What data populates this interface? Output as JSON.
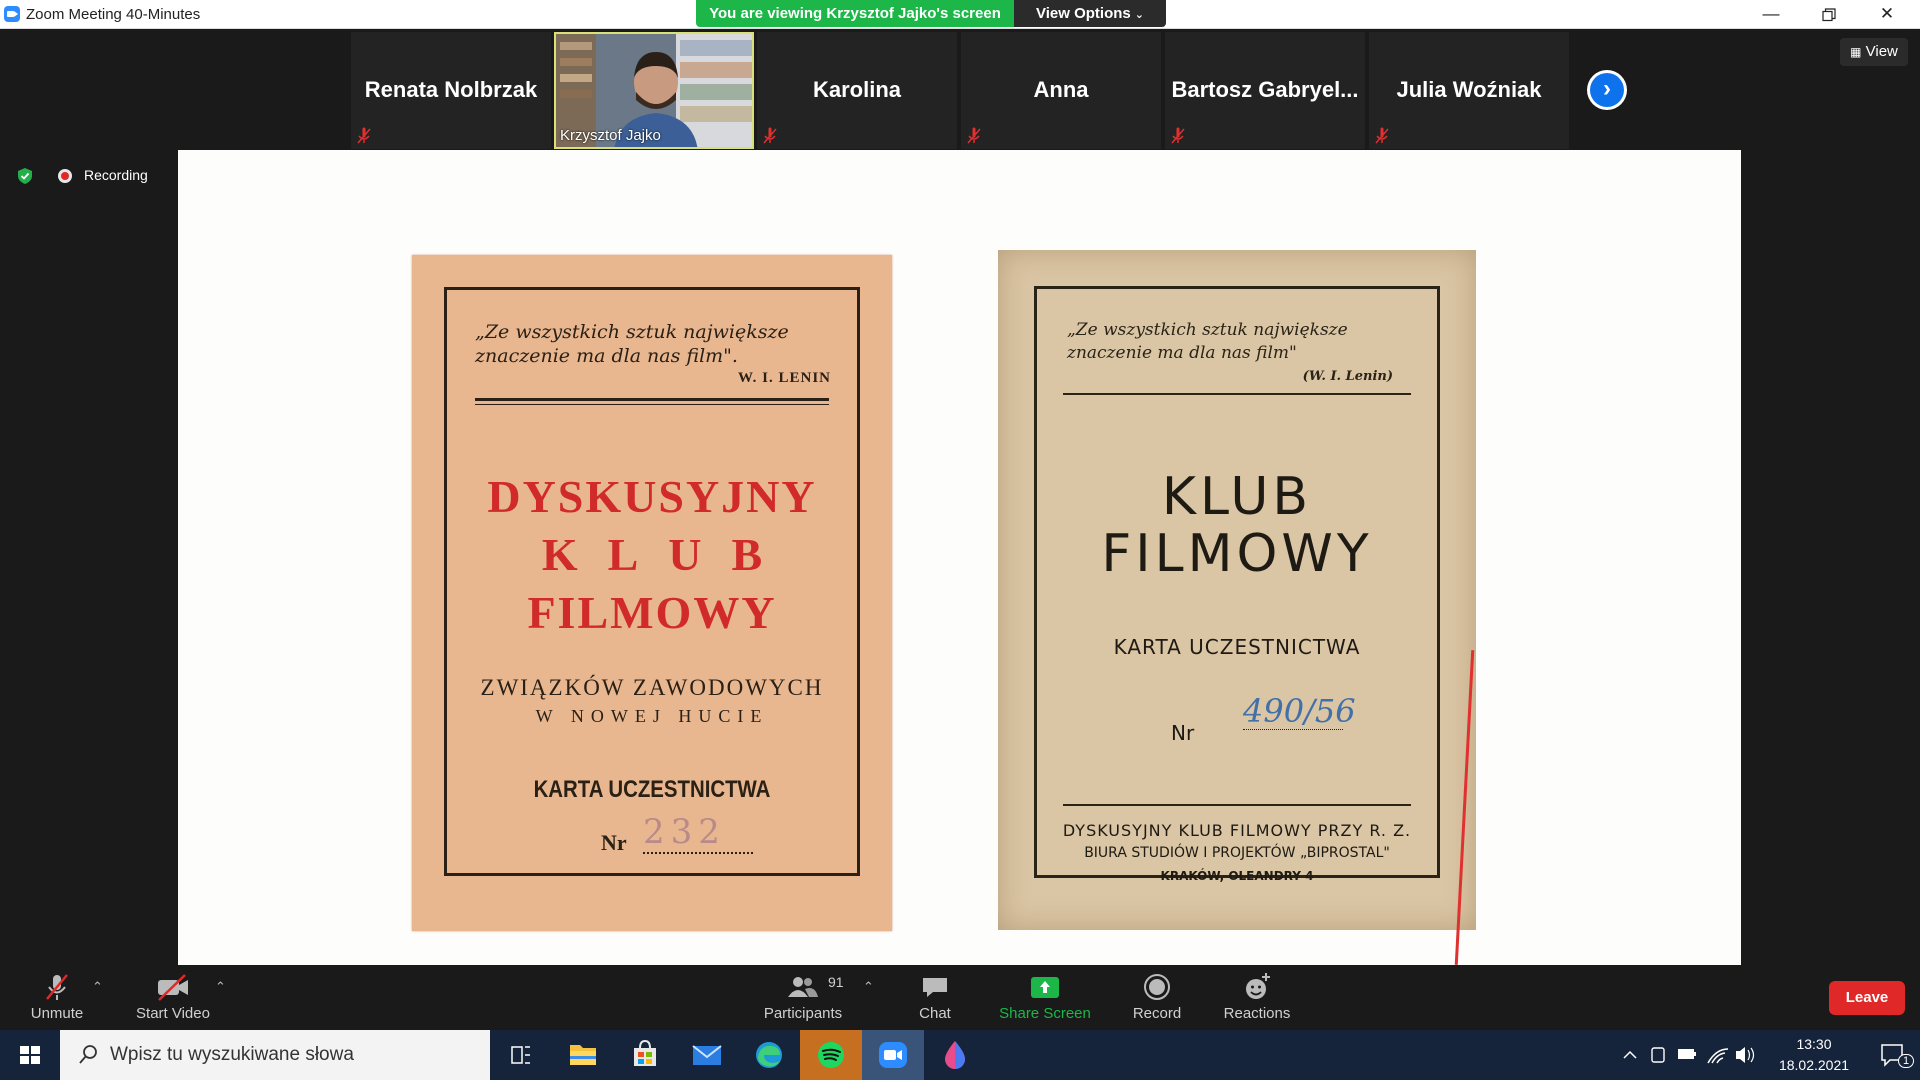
{
  "window": {
    "title": "Zoom Meeting 40-Minutes",
    "share_banner": "You are viewing Krzysztof Jajko's screen",
    "view_options": "View Options",
    "view_button": "View",
    "recording_label": "Recording"
  },
  "participants_strip": [
    {
      "name": "Renata Nolbrzak",
      "muted": true
    },
    {
      "name": "Krzysztof Jajko",
      "video": true
    },
    {
      "name": "Karolina",
      "muted": true
    },
    {
      "name": "Anna",
      "muted": true
    },
    {
      "name": "Bartosz Gabryel...",
      "muted": true
    },
    {
      "name": "Julia Woźniak",
      "muted": true
    }
  ],
  "shared_content": {
    "card_left": {
      "quote": "„Ze wszystkich sztuk największe znaczenie ma dla nas film\".",
      "author": "W. I. LENIN",
      "title_line1": "DYSKUSYJNY",
      "title_line2": "KLUB",
      "title_line3": "FILMOWY",
      "subtitle_line1": "ZWIĄZKÓW ZAWODOWYCH",
      "subtitle_line2": "W NOWEJ HUCIE",
      "card_label": "KARTA UCZESTNICTWA",
      "nr_label": "Nr",
      "number": "232"
    },
    "card_right": {
      "quote": "„Ze wszystkich sztuk największe znaczenie ma dla nas film\"",
      "author": "(W. I. Lenin)",
      "title_line1": "KLUB",
      "title_line2": "FILMOWY",
      "card_label": "KARTA UCZESTNICTWA",
      "nr_label": "Nr",
      "number": "490/56",
      "footer_line1": "DYSKUSYJNY KLUB FILMOWY PRZY R. Z.",
      "footer_line2": "BIURA STUDIÓW I PROJEKTÓW „BIPROSTAL\"",
      "footer_line3": "KRAKÓW, OLEANDRY 4"
    }
  },
  "toolbar": {
    "unmute": "Unmute",
    "start_video": "Start Video",
    "participants": "Participants",
    "participants_count": "91",
    "chat": "Chat",
    "share_screen": "Share Screen",
    "record": "Record",
    "reactions": "Reactions",
    "leave": "Leave"
  },
  "taskbar": {
    "search_placeholder": "Wpisz tu wyszukiwane słowa",
    "time": "13:30",
    "date": "18.02.2021",
    "notification_count": "1"
  },
  "colors": {
    "share_green": "#1db649",
    "leave_red": "#e02828",
    "zoom_blue": "#0e72ed",
    "card_left_bg": "#e8b68f",
    "card_left_red": "#d02a2a",
    "card_right_bg": "#dac5a4"
  }
}
